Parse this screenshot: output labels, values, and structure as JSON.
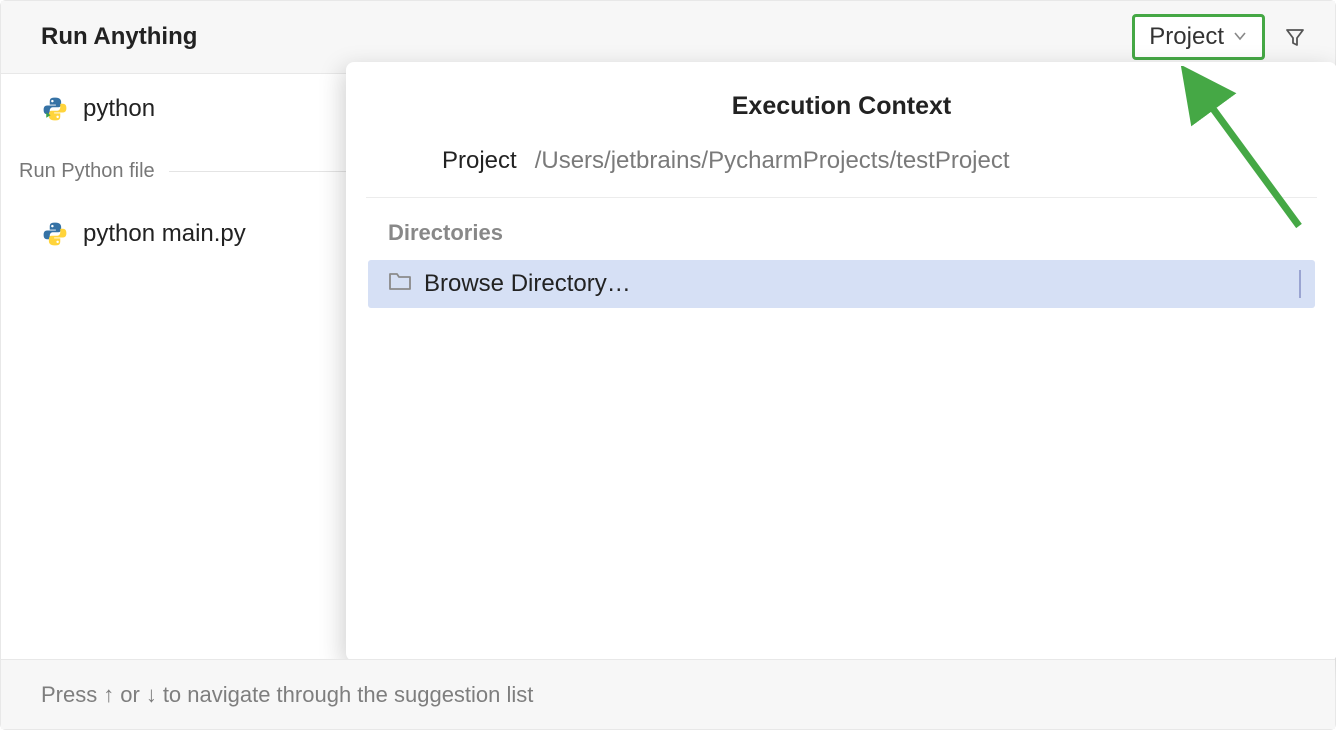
{
  "header": {
    "title": "Run Anything",
    "project_dropdown_label": "Project"
  },
  "suggestions": {
    "top_item": "python",
    "section_label": "Run Python file",
    "file_item": "python main.py"
  },
  "popover": {
    "title": "Execution Context",
    "path_label": "Project",
    "path_value": "/Users/jetbrains/PycharmProjects/testProject",
    "directories_heading": "Directories",
    "browse_label": "Browse Directory…"
  },
  "footer": {
    "prefix": "Press",
    "up": "↑",
    "or": "or",
    "down": "↓",
    "suffix": "to navigate through the suggestion list"
  }
}
